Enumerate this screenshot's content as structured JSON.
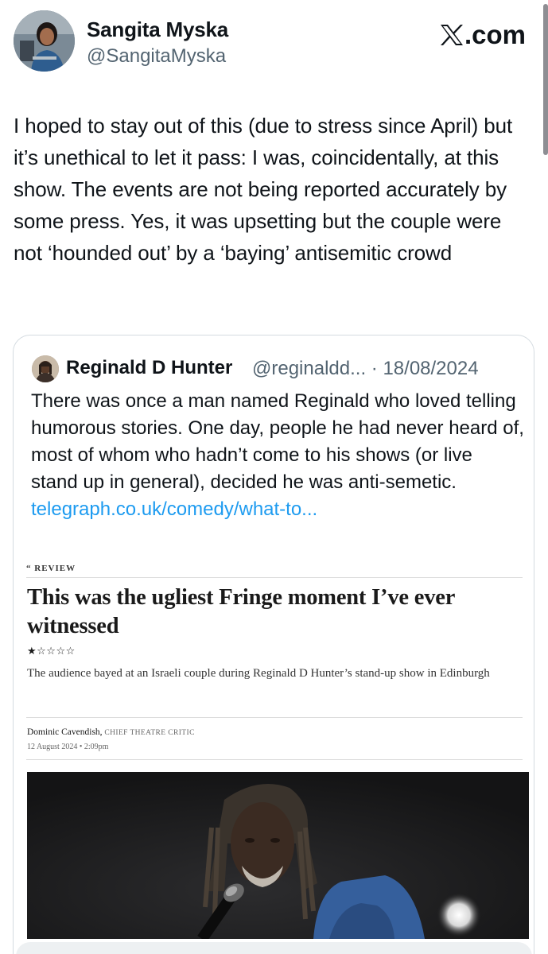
{
  "header": {
    "author_name": "Sangita Myska",
    "author_handle": "@SangitaMyska",
    "site_label": ".com",
    "icons": {
      "site_logo": "x-logo-icon",
      "avatar": "profile-photo"
    }
  },
  "tweet": {
    "text": "I hoped to stay out of this (due to stress since April) but it’s unethical to let it pass: I was, coincidentally, at this show. The events are not being reported accurately by some press. Yes, it was upsetting but the couple were not ‘hounded out’ by a ‘baying’ antisemitic crowd"
  },
  "quote": {
    "author_name": "Reginald D Hunter",
    "author_handle": "@reginaldd...",
    "separator": "·",
    "date": "18/08/2024",
    "text": "There was once a man named Reginald who loved telling humorous stories. One day, people he had never heard of, most of whom who hadn’t come to his shows (or live stand up in general), decided he was anti-semetic. ",
    "link_text": "telegraph.co.uk/comedy/what-to..."
  },
  "article": {
    "tag": "“ REVIEW",
    "headline": "This was the ugliest Fringe moment I’ve ever witnessed",
    "rating_text": "★☆☆☆☆",
    "rating": 1,
    "rating_max": 5,
    "standfirst": "The audience bayed at an Israeli couple during Reginald D Hunter’s stand-up show in Edinburgh",
    "byline_name": "Dominic Cavendish,",
    "byline_role": "CHIEF THEATRE CRITIC",
    "dateline": "12 August 2024 • 2:09pm"
  },
  "colors": {
    "text": "#0f1419",
    "secondary": "#536471",
    "link": "#1d9bf0",
    "border": "#d4dbe0"
  }
}
